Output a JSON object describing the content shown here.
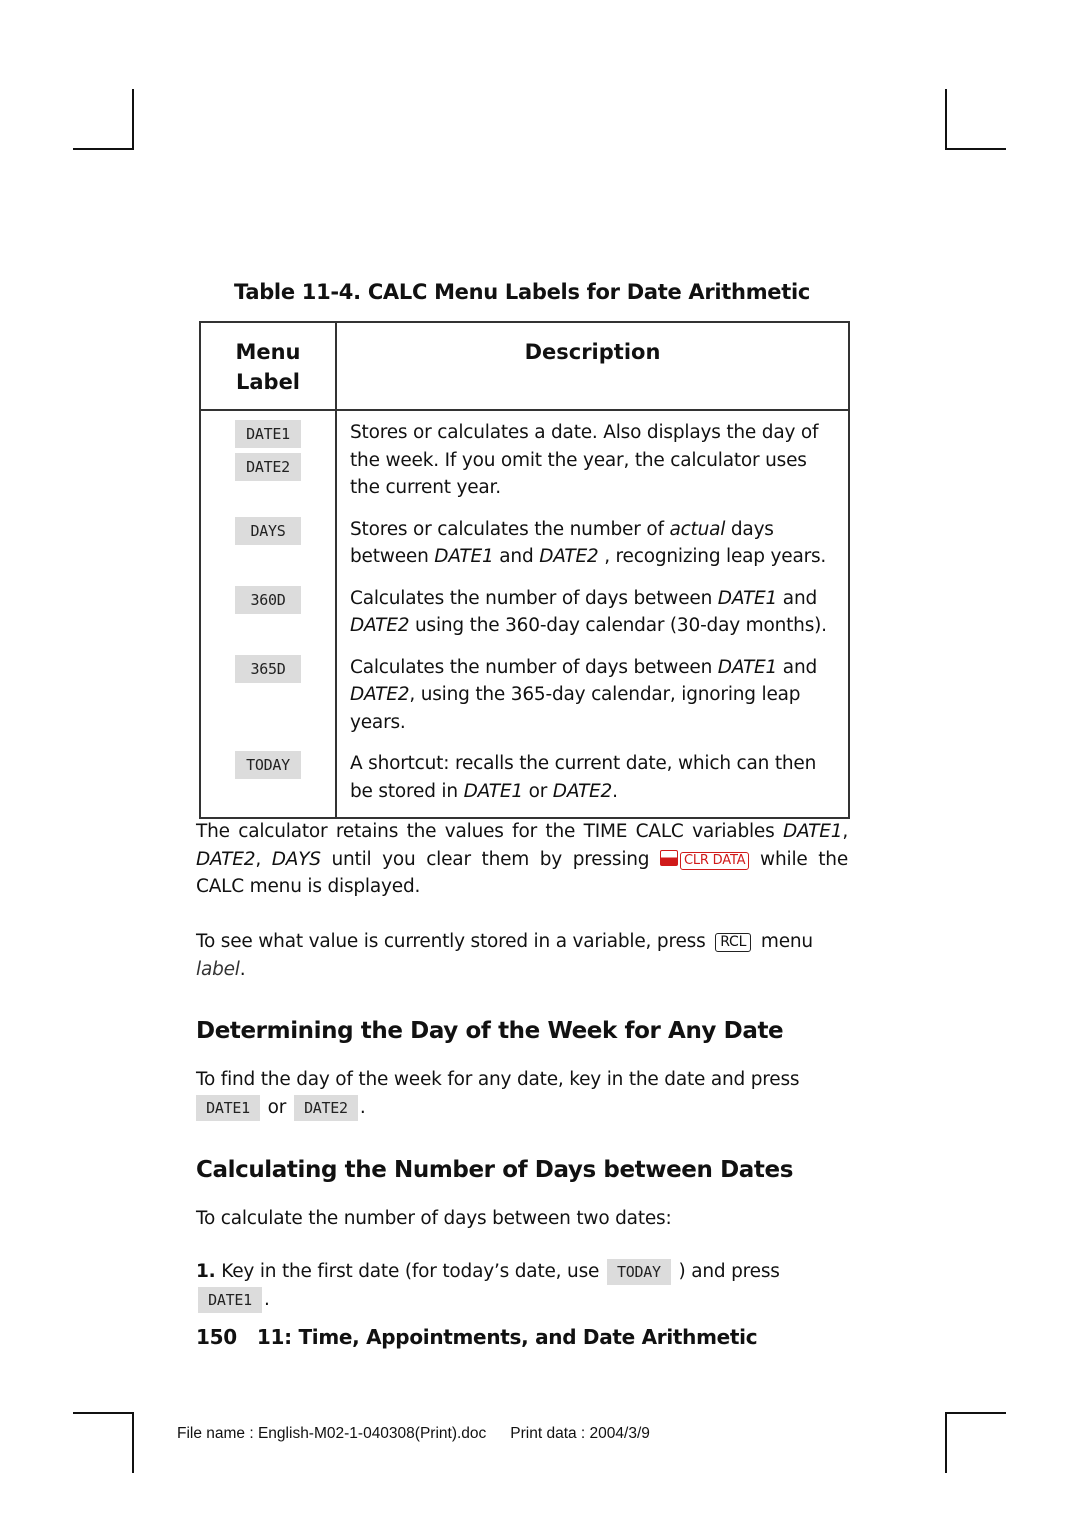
{
  "table": {
    "caption": "Table 11-4. CALC Menu Labels for Date Arithmetic",
    "headers": {
      "menu_label": "Menu Label",
      "description": "Description"
    },
    "rows": [
      {
        "keys": [
          "DATE1",
          "DATE2"
        ],
        "description_parts": [
          {
            "t": "Stores or calculates a date. Also displays the day of the week. If you omit the year, the calculator uses the current year."
          }
        ]
      },
      {
        "keys": [
          "DAYS"
        ],
        "description_parts": [
          {
            "t": "Stores or calculates the number of "
          },
          {
            "t": "actual",
            "i": true
          },
          {
            "t": " days between "
          },
          {
            "t": "DATE1",
            "i": true
          },
          {
            "t": " and "
          },
          {
            "t": "DATE2",
            "i": true
          },
          {
            "t": " , recognizing leap years."
          }
        ]
      },
      {
        "keys": [
          "360D"
        ],
        "description_parts": [
          {
            "t": "Calculates the number of days between "
          },
          {
            "t": "DATE1",
            "i": true
          },
          {
            "t": " and "
          },
          {
            "t": "DATE2",
            "i": true
          },
          {
            "t": " using the 360-day calendar (30-day months)."
          }
        ]
      },
      {
        "keys": [
          "365D"
        ],
        "description_parts": [
          {
            "t": "Calculates the number of days between "
          },
          {
            "t": "DATE1",
            "i": true
          },
          {
            "t": " and "
          },
          {
            "t": "DATE2",
            "i": true
          },
          {
            "t": ", using the 365-day calendar, ignoring leap years."
          }
        ]
      },
      {
        "keys": [
          "TODAY"
        ],
        "description_parts": [
          {
            "t": "A shortcut: recalls the current date, which can then be stored in "
          },
          {
            "t": "DATE1",
            "i": true
          },
          {
            "t": " or "
          },
          {
            "t": "DATE2",
            "i": true
          },
          {
            "t": "."
          }
        ]
      }
    ]
  },
  "para1": {
    "a": "The calculator retains the values for the TIME CALC variables ",
    "v1": "DATE1",
    "b": ", ",
    "v2": "DATE2",
    "c": ", ",
    "v3": "DAYS",
    "d": " until you clear them by pressing ",
    "key": "CLR DATA",
    "e": " while the CALC menu is displayed."
  },
  "para2": {
    "a": "To see what value is currently stored in a variable, press ",
    "key": "RCL",
    "b": " menu ",
    "c": "label",
    "d": "."
  },
  "section1": {
    "heading": "Determining the Day of the Week for Any Date",
    "text": "To find the day of the week for any date, key in the date and press",
    "key1": "DATE1",
    "or": " or ",
    "key2": "DATE2",
    "end": "."
  },
  "section2": {
    "heading": "Calculating the Number of Days between Dates",
    "intro": "To calculate the number of days between two dates:",
    "step_number": "1.",
    "step_a": " Key in the first date (for today’s date, use ",
    "step_key1": "TODAY",
    "step_b": " ) and press ",
    "step_key2": "DATE1",
    "step_c": "."
  },
  "footer": {
    "page_number": "150",
    "chapter_title": "11: Time, Appointments, and Date Arithmetic",
    "file_name": "File name : English-M02-1-040308(Print).doc",
    "print_data": "Print data : 2004/3/9"
  }
}
